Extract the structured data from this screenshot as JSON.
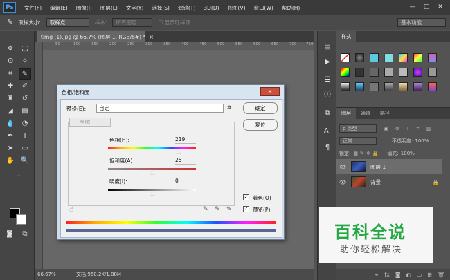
{
  "menubar": {
    "logo": "Ps",
    "items": [
      "文件(F)",
      "编辑(E)",
      "图像(I)",
      "图层(L)",
      "文字(Y)",
      "选择(S)",
      "滤镜(T)",
      "3D(D)",
      "视图(V)",
      "窗口(W)",
      "帮助(H)"
    ],
    "minimize": "—",
    "restore": "□",
    "close": "✕"
  },
  "options": {
    "sample_size_label": "取样大小:",
    "sample_size_value": "取样点",
    "sample_label": "样本:",
    "sample_value": "所有图层",
    "show_ring": "显示取样环",
    "workspace": "基本功能"
  },
  "document": {
    "tab_title": "timg (1).jpg @ 66.7% (图层 1, RGB/8#) *",
    "tab_close": "×",
    "ruler_ticks": [
      "50",
      "100",
      "150",
      "200",
      "250",
      "300",
      "350",
      "400",
      "450",
      "500",
      "550",
      "600",
      "650",
      "700",
      "750"
    ],
    "zoom": "66.67%",
    "file_info": "文档:960.2K/1.88M"
  },
  "styles_panel": {
    "tab": "样式"
  },
  "layers_panel": {
    "tabs": [
      "图层",
      "通道",
      "路径"
    ],
    "kind_label": "ρ 类型",
    "blend_mode": "正常",
    "opacity_label": "不透明度:",
    "opacity_value": "100%",
    "lock_label": "锁定:",
    "fill_label": "填充:",
    "fill_value": "100%",
    "layers": [
      {
        "name": "图层 1",
        "selected": true
      },
      {
        "name": "背景",
        "selected": false
      }
    ],
    "footer_icons": [
      "link-icon",
      "fx-icon",
      "mask-icon",
      "adjustment-icon",
      "folder-icon",
      "new-layer-icon",
      "trash-icon"
    ]
  },
  "dialog": {
    "title": "色相/饱和度",
    "preset_label": "预设(E):",
    "preset_value": "自定",
    "ok": "确定",
    "reset": "复位",
    "channel": "全图",
    "hue_label": "色相(H):",
    "hue_value": "219",
    "saturation_label": "饱和度(A):",
    "saturation_value": "25",
    "lightness_label": "明度(I):",
    "lightness_value": "0",
    "colorize_label": "着色(O)",
    "colorize_checked": true,
    "preview_label": "预览(P)",
    "preview_checked": true,
    "hue_fraction": 0.804,
    "saturation_fraction": 0.5,
    "lightness_fraction": 0.5
  },
  "watermark": {
    "main": "百科全说",
    "sub": "助你轻松解决"
  }
}
